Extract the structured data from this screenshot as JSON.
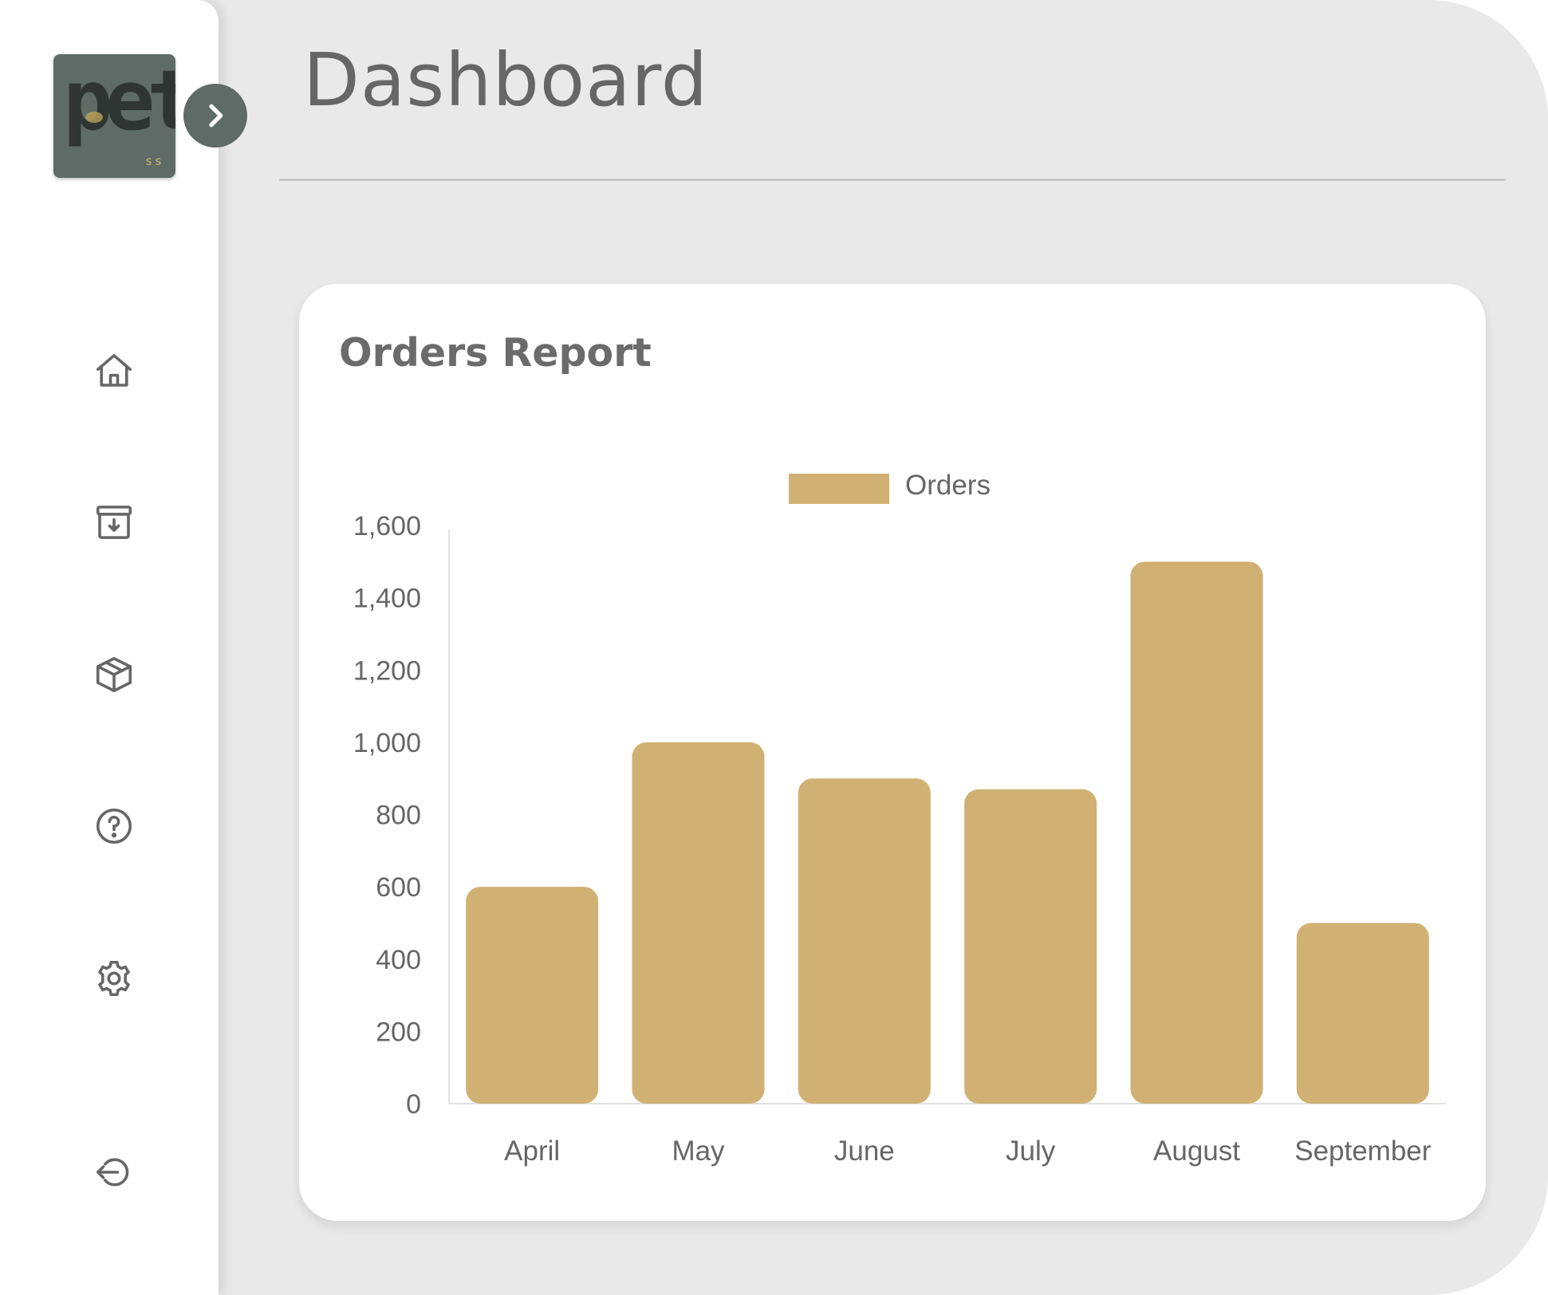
{
  "page": {
    "title": "Dashboard"
  },
  "sidebar": {
    "logo": {
      "text": "pet",
      "sub": "ss"
    },
    "expand_icon": "chevron-right-icon",
    "items": [
      {
        "name": "home",
        "icon": "home-icon"
      },
      {
        "name": "orders",
        "icon": "archive-download-icon"
      },
      {
        "name": "products",
        "icon": "package-icon"
      },
      {
        "name": "help",
        "icon": "help-circle-icon"
      },
      {
        "name": "settings",
        "icon": "gear-icon"
      },
      {
        "name": "logout",
        "icon": "logout-icon"
      }
    ]
  },
  "card": {
    "title": "Orders Report"
  },
  "colors": {
    "bar": "#d1b173",
    "sidebar_dark": "#5f6b66",
    "background": "#e9e9e9"
  },
  "chart_data": {
    "type": "bar",
    "title": "Orders Report",
    "categories": [
      "April",
      "May",
      "June",
      "July",
      "August",
      "September"
    ],
    "series": [
      {
        "name": "Orders",
        "values": [
          600,
          1000,
          900,
          870,
          1500,
          500
        ]
      }
    ],
    "ylim": [
      0,
      1600
    ],
    "yticks": [
      "0",
      "200",
      "400",
      "600",
      "800",
      "1,000",
      "1,200",
      "1,400",
      "1,600"
    ],
    "xlabel": "",
    "ylabel": "",
    "legend": "top-center",
    "grid": false
  }
}
